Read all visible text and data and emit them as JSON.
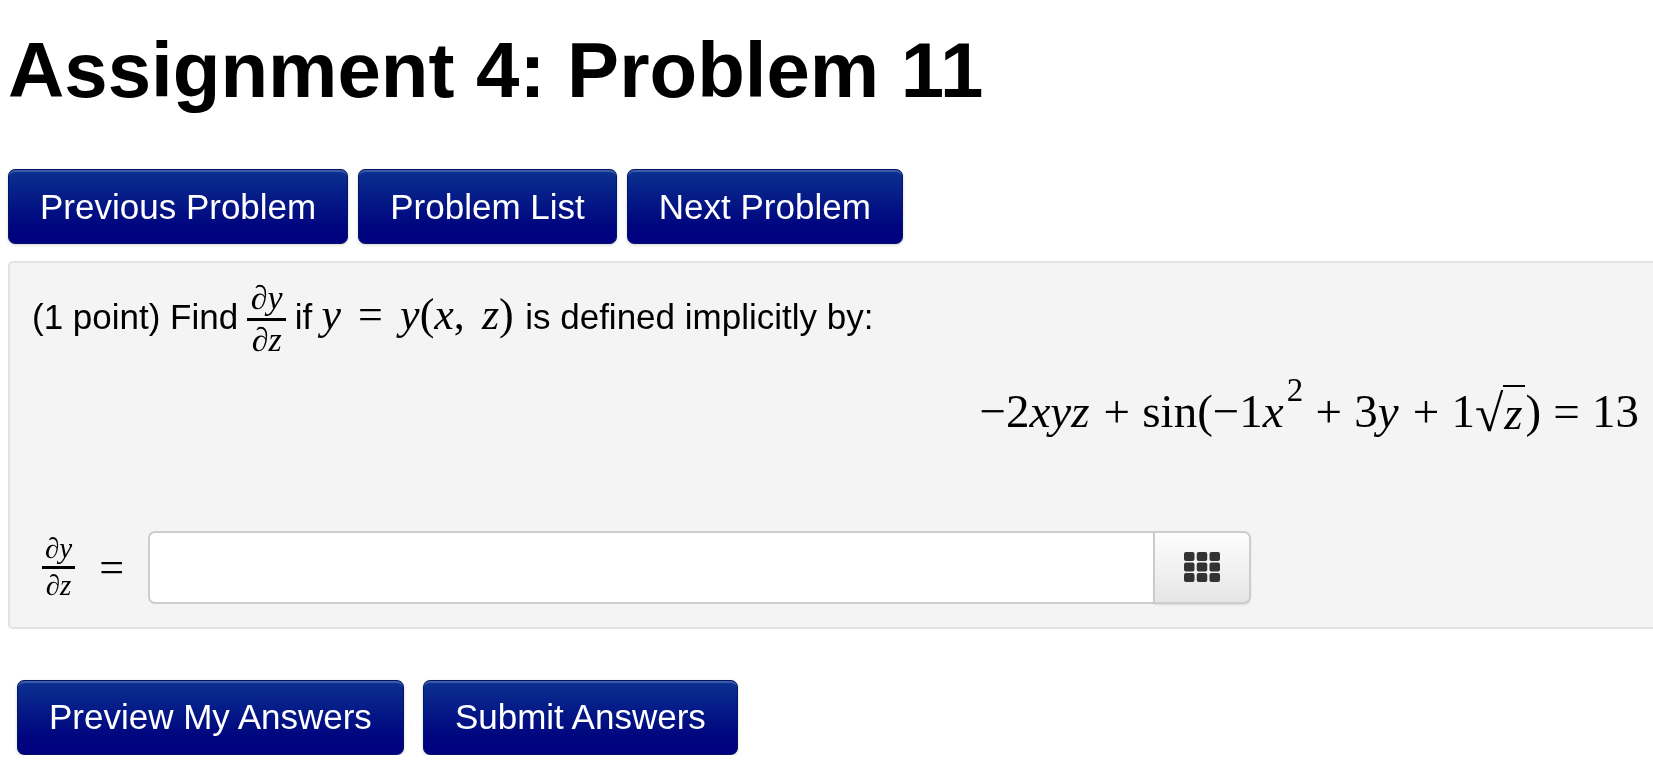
{
  "title": "Assignment 4: Problem 11",
  "nav_buttons": [
    {
      "label": "Previous Problem"
    },
    {
      "label": "Problem List"
    },
    {
      "label": "Next Problem"
    }
  ],
  "problem": {
    "statement": [
      {
        "kind": "text",
        "text": "(1 point) Find"
      },
      {
        "kind": "fraction",
        "numerator": "∂*y*",
        "denominator": "∂*z*"
      },
      {
        "kind": "text",
        "text": "if"
      },
      {
        "kind": "math",
        "text": "*y* = *y*(*x*, *z*)"
      },
      {
        "kind": "text",
        "text": "is defined implicitly by:"
      }
    ],
    "equation": [
      {
        "kind": "math",
        "text": "−2"
      },
      {
        "kind": "var",
        "text": "xyz"
      },
      {
        "kind": "op",
        "text": "+"
      },
      {
        "kind": "math",
        "text": "sin(−1"
      },
      {
        "kind": "var",
        "text": "x"
      },
      {
        "kind": "sup",
        "text": "2"
      },
      {
        "kind": "op",
        "text": "+"
      },
      {
        "kind": "math",
        "text": "3"
      },
      {
        "kind": "var",
        "text": "y"
      },
      {
        "kind": "op",
        "text": "+"
      },
      {
        "kind": "math",
        "text": "1"
      },
      {
        "kind": "sqrt",
        "sign": "√",
        "radicand": "z"
      },
      {
        "kind": "math",
        "text": ")"
      },
      {
        "kind": "op",
        "text": "="
      },
      {
        "kind": "math",
        "text": "13"
      }
    ],
    "answer": {
      "label": [
        {
          "kind": "fraction",
          "numerator": "∂*y*",
          "denominator": "∂*z*"
        },
        {
          "kind": "op",
          "text": "="
        }
      ]
    }
  },
  "action_buttons": [
    {
      "label": "Preview My Answers"
    },
    {
      "label": "Submit Answers"
    }
  ]
}
